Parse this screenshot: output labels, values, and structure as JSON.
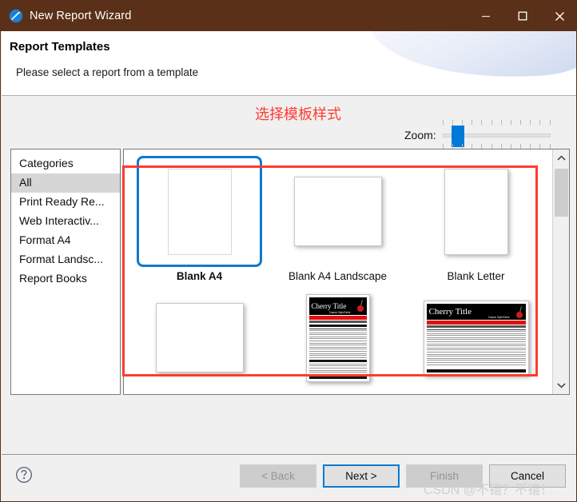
{
  "window": {
    "title": "New Report Wizard",
    "icon": "report-wizard-icon",
    "title_bar_color": "#5a3018",
    "minimize_label": "Minimize",
    "maximize_label": "Maximize",
    "close_label": "Close"
  },
  "header": {
    "title": "Report Templates",
    "subtitle": "Please select a report from a template"
  },
  "annotation": {
    "label": "选择模板样式",
    "color": "#ff3b30"
  },
  "zoom": {
    "label": "Zoom:",
    "value": 10,
    "min": 0,
    "max": 100,
    "tick_count": 12
  },
  "categories": {
    "header": "Categories",
    "items": [
      {
        "label": "All",
        "selected": true
      },
      {
        "label": "Print Ready Re...",
        "selected": false
      },
      {
        "label": "Web Interactiv...",
        "selected": false
      },
      {
        "label": "Format A4",
        "selected": false
      },
      {
        "label": "Format Landsc...",
        "selected": false
      },
      {
        "label": "Report Books",
        "selected": false
      }
    ]
  },
  "templates": {
    "rows": [
      [
        {
          "label": "Blank A4",
          "kind": "blank-portrait",
          "selected": true
        },
        {
          "label": "Blank A4 Landscape",
          "kind": "blank-landscape",
          "selected": false
        },
        {
          "label": "Blank Letter",
          "kind": "blank-portrait-shadow",
          "selected": false
        }
      ],
      [
        {
          "label": "",
          "kind": "blank-landscape",
          "selected": false
        },
        {
          "label": "",
          "kind": "cherry-portrait",
          "selected": false
        },
        {
          "label": "",
          "kind": "cherry-landscape",
          "selected": false
        }
      ]
    ],
    "cherry_title": "Cherry Title",
    "cherry_subtitle": "Classic Style/Table"
  },
  "scrollbar": {
    "up_icon": "chevron-up-icon",
    "down_icon": "chevron-down-icon"
  },
  "footer": {
    "help_icon": "help-question-icon",
    "buttons": [
      {
        "label": "< Back",
        "state": "disabled"
      },
      {
        "label": "Next >",
        "state": "focused"
      },
      {
        "label": "Finish",
        "state": "disabled"
      },
      {
        "label": "Cancel",
        "state": "enabled"
      }
    ],
    "watermark": "CSDN @不错？不错！"
  }
}
